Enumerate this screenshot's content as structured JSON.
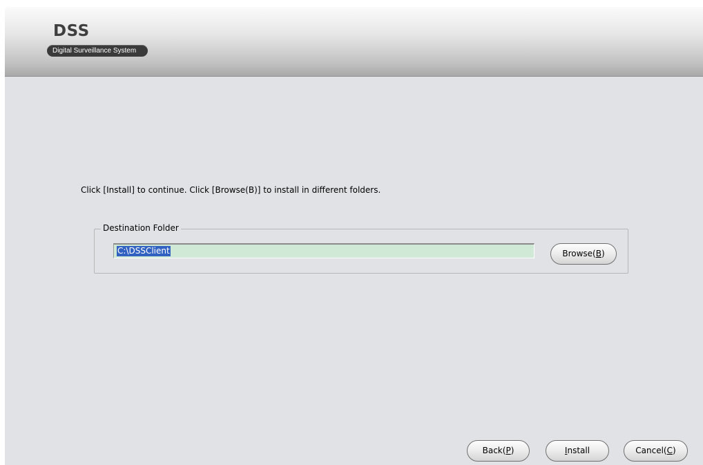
{
  "header": {
    "logo_title": "DSS",
    "logo_subtitle": "Digital Surveillance System"
  },
  "content": {
    "instruction": "Click [Install] to continue. Click [Browse(B)] to install in different folders.",
    "destination_group_label": "Destination Folder",
    "folder_path_value": "C:\\DSSClient"
  },
  "buttons": {
    "browse": {
      "prefix": "Browse(",
      "accel": "B",
      "suffix": ")"
    },
    "back": {
      "prefix": "Back(",
      "accel": "P",
      "suffix": ")"
    },
    "install": {
      "prefix": "",
      "accel": "I",
      "suffix": "nstall"
    },
    "cancel": {
      "prefix": "Cancel(",
      "accel": "C",
      "suffix": ")"
    }
  },
  "colors": {
    "window_background": "#e1e2e6",
    "input_background": "#d0e8d6",
    "selection_highlight": "#3162c2",
    "logo_badge": "#3a3a3a"
  }
}
